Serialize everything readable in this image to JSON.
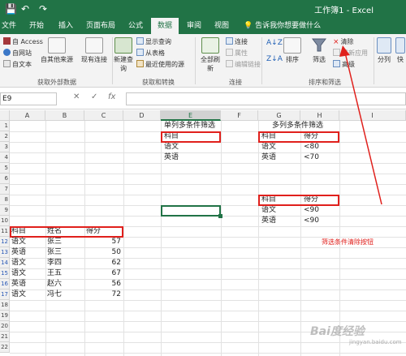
{
  "quick_access": {
    "save": "💾",
    "undo": "↶",
    "redo": "↷"
  },
  "window_title": "工作簿1 - Excel",
  "tabs": [
    "文件",
    "开始",
    "插入",
    "页面布局",
    "公式",
    "数据",
    "审阅",
    "视图"
  ],
  "active_tab": "数据",
  "tell_me": "告诉我你想要做什么",
  "ribbon": {
    "external": {
      "access": "自 Access",
      "web": "自网站",
      "text": "自文本",
      "other": "自其他来源",
      "existing": "现有连接",
      "label": "获取外部数据"
    },
    "transform": {
      "new_query": "新建查询",
      "show_queries": "显示查询",
      "from_table": "从表格",
      "recent": "最近使用的源",
      "label": "获取和转换"
    },
    "connections": {
      "refresh_all": "全部刷新",
      "connections": "连接",
      "properties": "属性",
      "edit_links": "编辑链接",
      "label": "连接"
    },
    "sort_filter": {
      "sort": "排序",
      "filter": "筛选",
      "clear": "清除",
      "reapply": "重新应用",
      "advanced": "高级",
      "label": "排序和筛选"
    },
    "tools": {
      "text_to_columns": "分列",
      "quick_fill": "快"
    }
  },
  "formula_bar": {
    "name_box": "E9",
    "cancel": "✕",
    "enter": "✓",
    "fx": "fx",
    "value": ""
  },
  "columns": [
    "A",
    "B",
    "C",
    "D",
    "E",
    "F",
    "G",
    "H",
    "I"
  ],
  "rows": [
    "1",
    "2",
    "3",
    "4",
    "5",
    "6",
    "7",
    "8",
    "9",
    "10",
    "11",
    "12",
    "13",
    "14",
    "15",
    "16",
    "17",
    "18",
    "19",
    "20",
    "21",
    "22"
  ],
  "sheet": {
    "single_title": "单列多条件筛选",
    "single_header": "科目",
    "single_values": [
      "语文",
      "英语"
    ],
    "multi_title": "多列多条件筛选",
    "multi1_header": [
      "科目",
      "得分"
    ],
    "multi1_rows": [
      [
        "语文",
        "<80"
      ],
      [
        "英语",
        "<70"
      ]
    ],
    "multi2_header": [
      "科目",
      "得分"
    ],
    "multi2_rows": [
      [
        "语文",
        "<90"
      ],
      [
        "英语",
        "<90"
      ]
    ],
    "data_header": [
      "科目",
      "姓名",
      "得分"
    ],
    "data_rows": [
      [
        "语文",
        "张三",
        "57"
      ],
      [
        "英语",
        "张三",
        "50"
      ],
      [
        "语文",
        "李四",
        "62"
      ],
      [
        "语文",
        "王五",
        "67"
      ],
      [
        "英语",
        "赵六",
        "56"
      ],
      [
        "语文",
        "冯七",
        "72"
      ]
    ]
  },
  "annotation": "筛选条件清除按钮",
  "watermark": {
    "main": "Bai度经验",
    "sub": "jingyan.baidu.com"
  },
  "colors": {
    "excel_green": "#217346",
    "annotation_red": "#e0201c",
    "ribbon_bg": "#f3f3f3"
  }
}
